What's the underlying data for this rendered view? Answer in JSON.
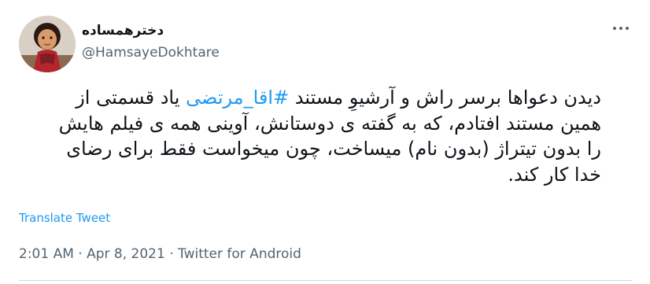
{
  "author": {
    "display_name": "دخترهمساده",
    "handle": "@HamsayeDokhtare"
  },
  "tweet": {
    "text_before": "دیدن دعواها برسر راش و آرشیوِ مستند ",
    "hashtag": "#اقا_مرتضی",
    "text_after": " یاد قسمتی از همین مستند افتادم، که به گفته ی دوستانش، آوینی همه ی فیلم هایش را  بدون تیتراژ (بدون نام) میساخت، چون میخواست فقط برای رضای خدا کار کند.",
    "translate_label": "Translate Tweet"
  },
  "meta": {
    "time": "2:01 AM",
    "separator1": " · ",
    "date": "Apr 8, 2021",
    "separator2": " · ",
    "source": "Twitter for Android"
  },
  "icons": {
    "more": "more-horizontal-icon",
    "avatar": "avatar-image"
  },
  "colors": {
    "link": "#1d9bf0",
    "text": "#0f1419",
    "secondary": "#536471"
  }
}
